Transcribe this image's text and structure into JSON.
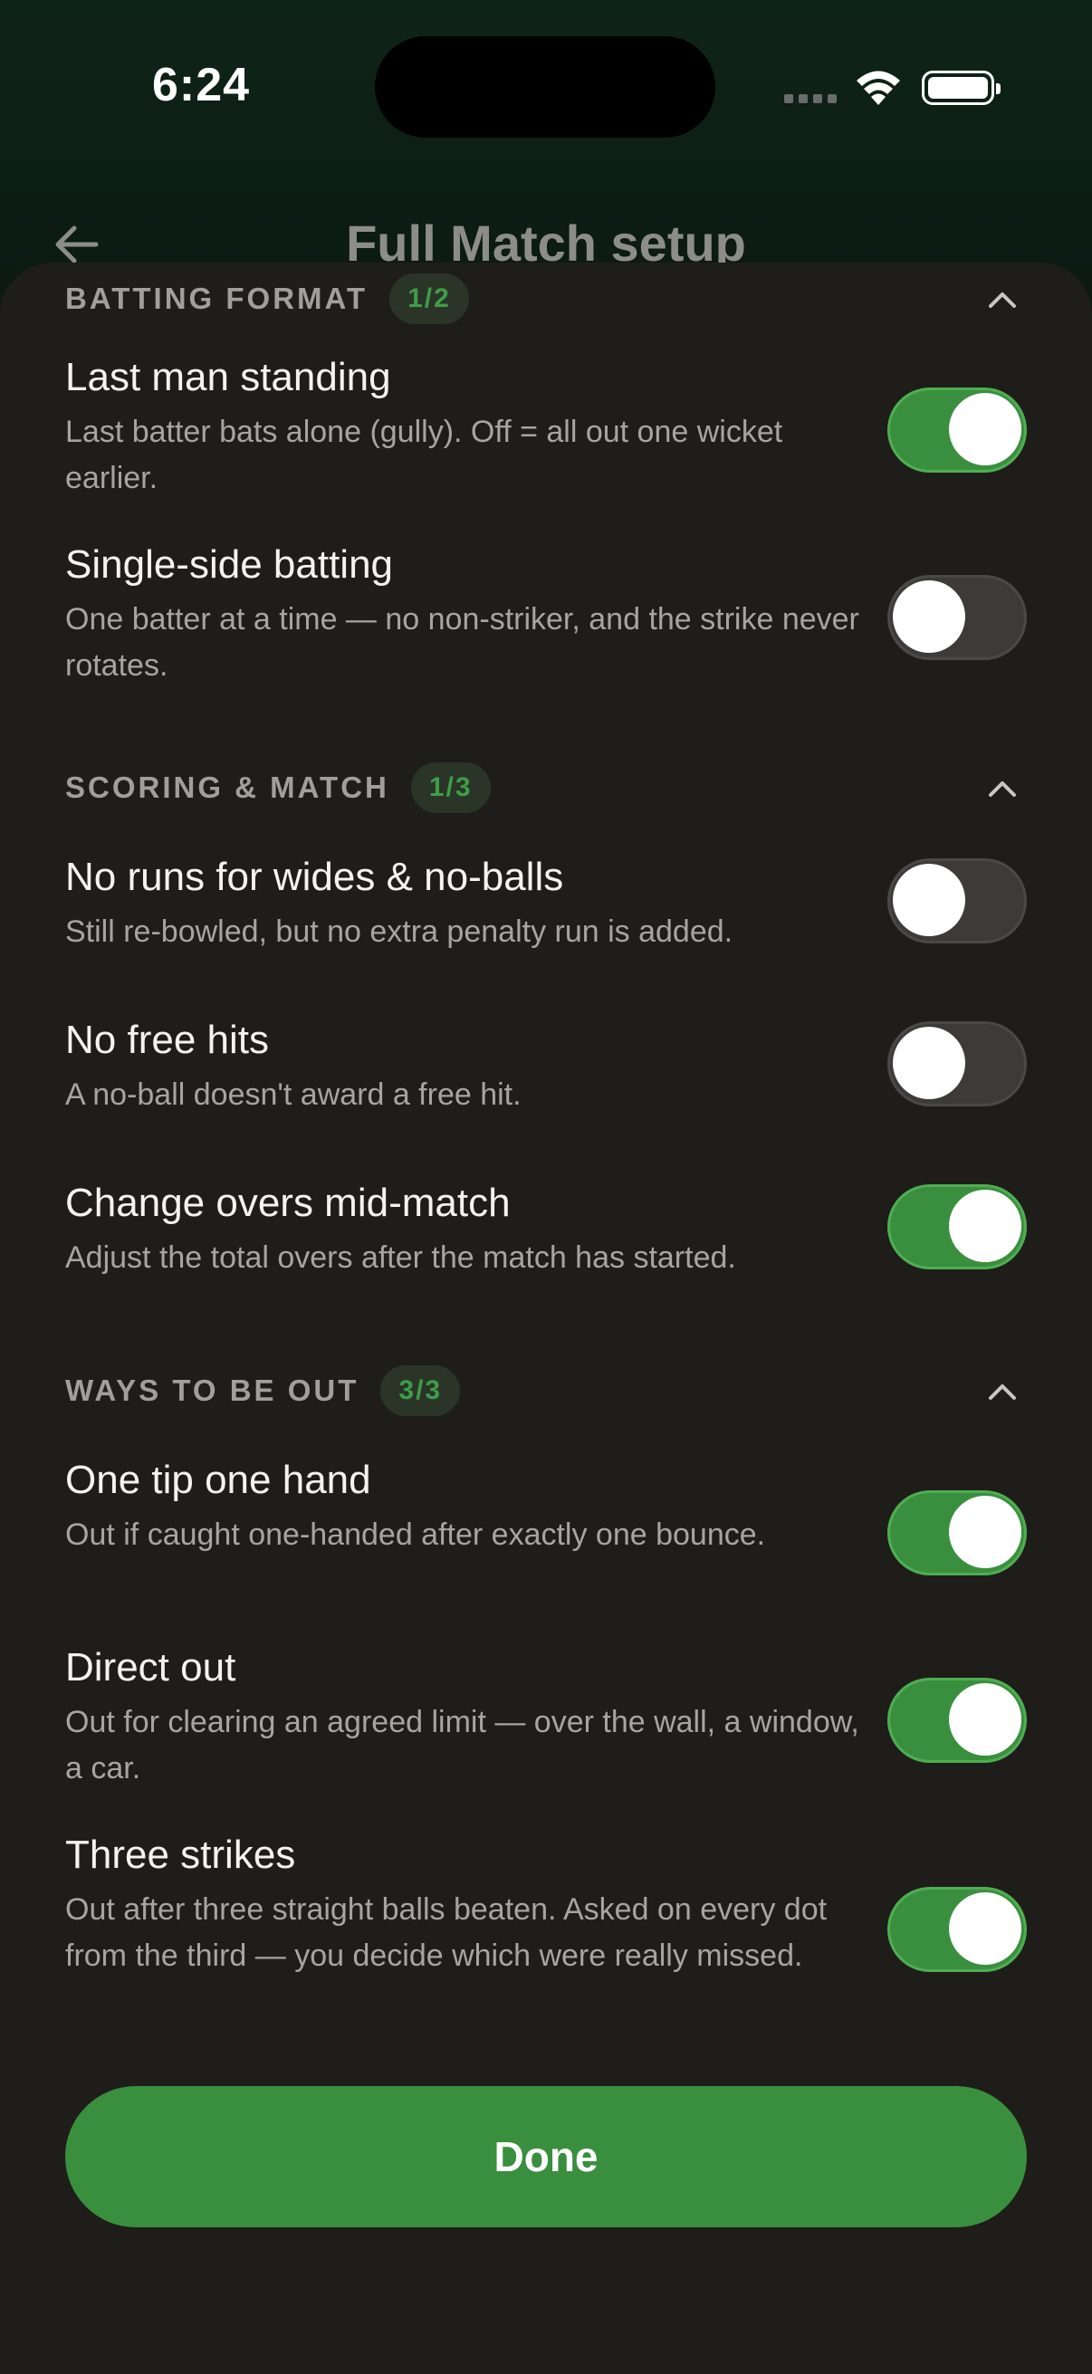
{
  "status_bar": {
    "time": "6:24"
  },
  "header": {
    "title": "Full Match setup"
  },
  "sections": [
    {
      "title": "BATTING FORMAT",
      "count": "1/2",
      "rows": [
        {
          "title": "Last man standing",
          "desc": "Last batter bats alone (gully). Off = all out one wicket earlier.",
          "on": true
        },
        {
          "title": "Single-side batting",
          "desc": "One batter at a time — no non-striker, and the strike never rotates.",
          "on": false
        }
      ]
    },
    {
      "title": "SCORING & MATCH",
      "count": "1/3",
      "rows": [
        {
          "title": "No runs for wides & no-balls",
          "desc": "Still re-bowled, but no extra penalty run is added.",
          "on": false
        },
        {
          "title": "No free hits",
          "desc": "A no-ball doesn't award a free hit.",
          "on": false
        },
        {
          "title": "Change overs mid-match",
          "desc": "Adjust the total overs after the match has started.",
          "on": true
        }
      ]
    },
    {
      "title": "WAYS TO BE OUT",
      "count": "3/3",
      "rows": [
        {
          "title": "One tip one hand",
          "desc": "Out if caught one-handed after exactly one bounce.",
          "on": true
        },
        {
          "title": "Direct out",
          "desc": "Out for clearing an agreed limit — over the wall, a window, a car.",
          "on": true
        },
        {
          "title": "Three strikes",
          "desc": "Out after three straight balls beaten. Asked on every dot from the third — you decide which were really missed.",
          "on": true
        }
      ]
    }
  ],
  "done_label": "Done",
  "colors": {
    "accent": "#3a8f3f",
    "sheet": "#1f1d1a",
    "pill_text": "#3f9c49"
  }
}
